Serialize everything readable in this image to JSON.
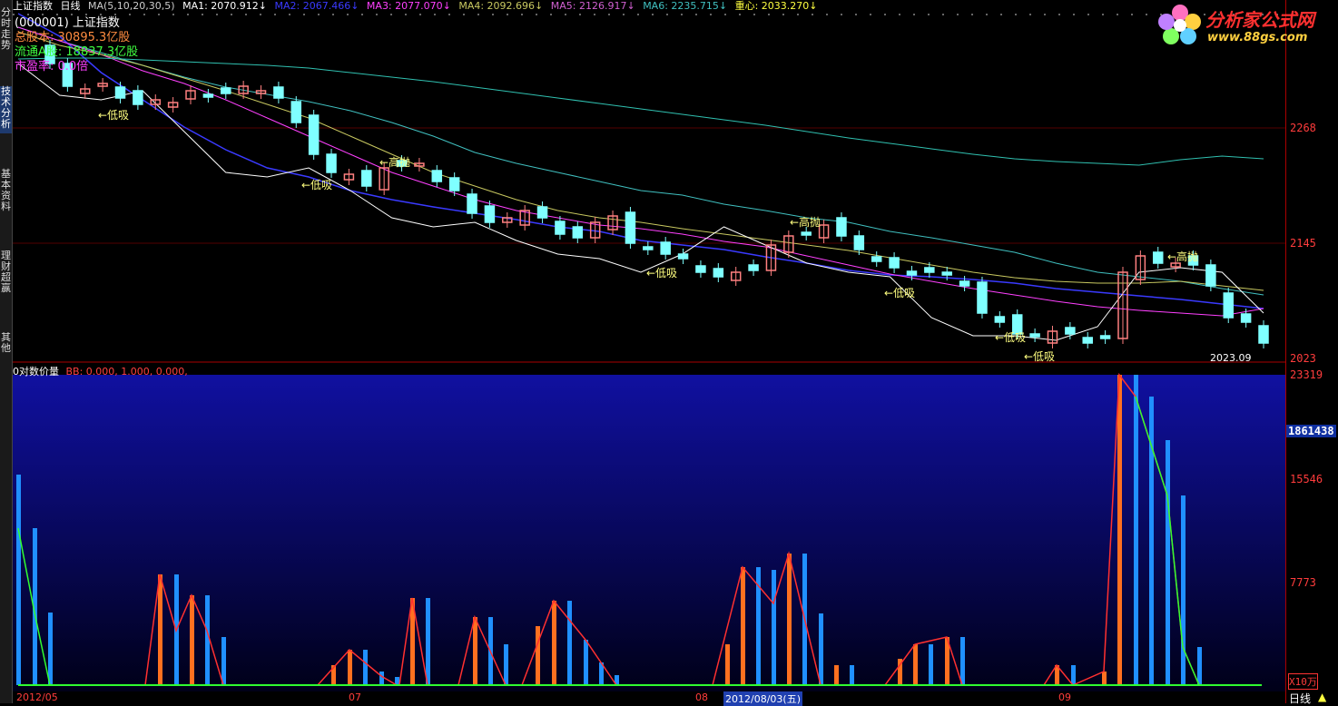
{
  "topbar": {
    "title": "上证指数",
    "period": "日线",
    "ma_params": "MA(5,10,20,30,5)",
    "ma1": "MA1: 2070.912↓",
    "ma2": "MA2: 2067.466↓",
    "ma3": "MA3: 2077.070↓",
    "ma4": "MA4: 2092.696↓",
    "ma5": "MA5: 2126.917↓",
    "ma6": "MA6: 2235.715↓",
    "center": "重心: 2033.270↓"
  },
  "info": {
    "name": "(000001) 上证指数",
    "total_shares": "总股本:    30895.3亿股",
    "float_shares": "流通A股:    18837.3亿股",
    "pe": "市盈率:     0.0倍"
  },
  "sidebar": {
    "tabs": [
      {
        "label": "分时走势"
      },
      {
        "label": "技术分析"
      },
      {
        "label": "基本资料"
      },
      {
        "label": "理财超赢"
      },
      {
        "label": "其他"
      }
    ]
  },
  "price_axis": {
    "labels": [
      "2268",
      "2145",
      "2023"
    ]
  },
  "volume_axis": {
    "labels": [
      "23319",
      "1861438",
      "15546",
      "7773"
    ],
    "unit": "X10万"
  },
  "volume_header": {
    "name": "0对数价量",
    "bb": "BB: 0.000, 1.000, 0.000,"
  },
  "annotations": {
    "high_sell": "←高抛",
    "low_buy": "←低吸",
    "date_tag": "2023.09"
  },
  "xaxis": {
    "labels": [
      "2012/05",
      "07",
      "08",
      "2012/08/03(五)",
      "09"
    ],
    "period_label": "日线"
  },
  "logo": {
    "brand": "分析家公式网",
    "url": "www.88gs.com"
  },
  "colors": {
    "up": "#ff8080",
    "down": "#7fffff",
    "ma1": "#ffffff",
    "ma2": "#3a3aff",
    "ma3": "#ff40ff",
    "ma4": "#c8c860",
    "ma5": "#ff60ff",
    "ma6": "#40c0c0",
    "axis": "#ff3c3c"
  }
}
